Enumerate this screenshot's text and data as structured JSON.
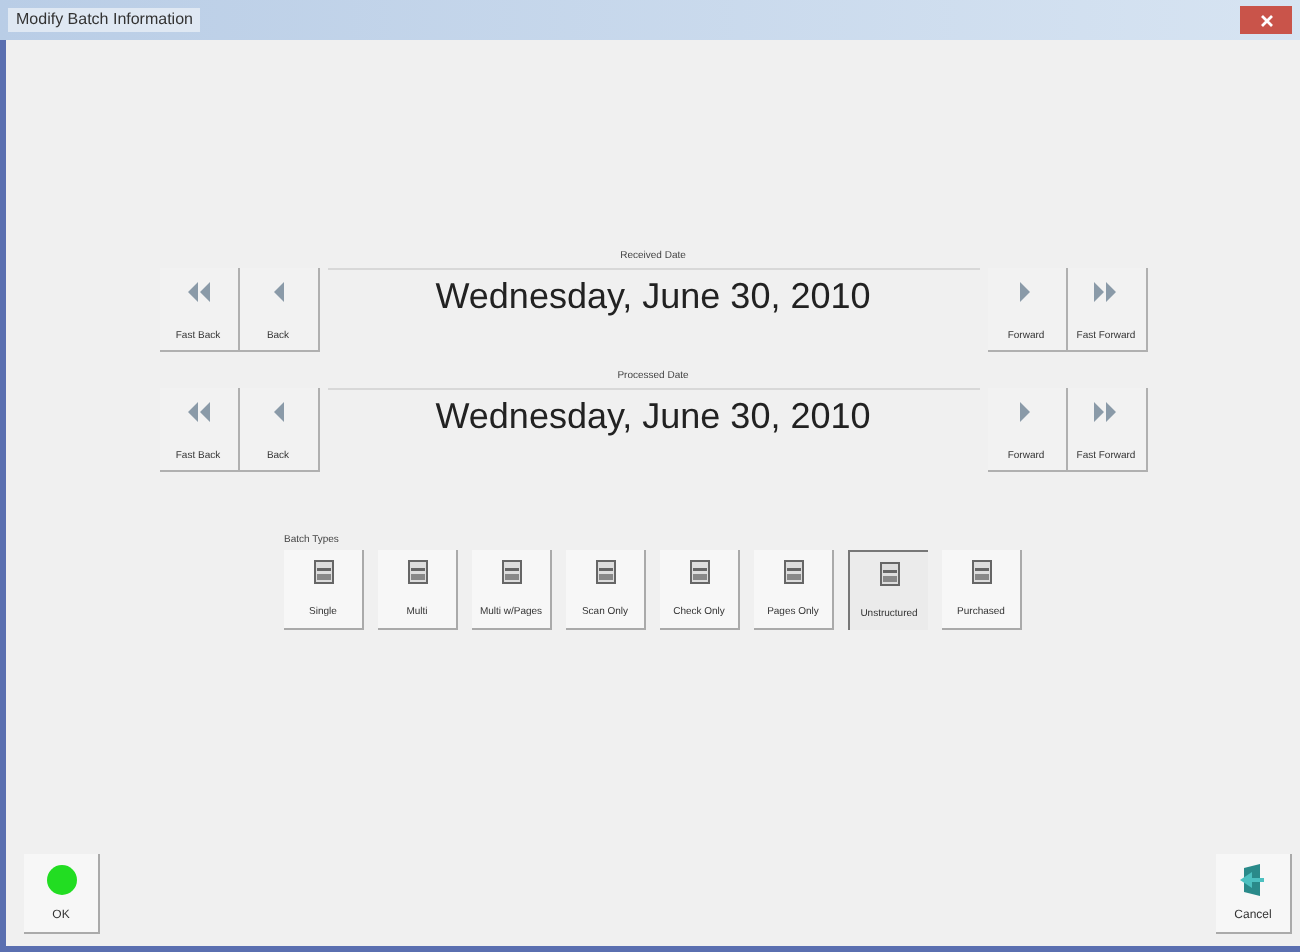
{
  "window": {
    "title": "Modify Batch Information"
  },
  "date_pickers": [
    {
      "label": "Received Date",
      "date": "Wednesday, June 30, 2010",
      "buttons": [
        {
          "kind": "fast-back",
          "label": "Fast Back"
        },
        {
          "kind": "back",
          "label": "Back"
        },
        {
          "kind": "forward",
          "label": "Forward"
        },
        {
          "kind": "fast-forward",
          "label": "Fast Forward"
        }
      ]
    },
    {
      "label": "Processed Date",
      "date": "Wednesday, June 30, 2010",
      "buttons": [
        {
          "kind": "fast-back",
          "label": "Fast Back"
        },
        {
          "kind": "back",
          "label": "Back"
        },
        {
          "kind": "forward",
          "label": "Forward"
        },
        {
          "kind": "fast-forward",
          "label": "Fast Forward"
        }
      ]
    }
  ],
  "batch_types": {
    "label": "Batch Types",
    "items": [
      {
        "label": "Single",
        "selected": false
      },
      {
        "label": "Multi",
        "selected": false
      },
      {
        "label": "Multi w/Pages",
        "selected": false
      },
      {
        "label": "Scan Only",
        "selected": false
      },
      {
        "label": "Check Only",
        "selected": false
      },
      {
        "label": "Pages Only",
        "selected": false
      },
      {
        "label": "Unstructured",
        "selected": true
      },
      {
        "label": "Purchased",
        "selected": false
      }
    ]
  },
  "footer": [
    {
      "kind": "ok",
      "label": "OK"
    },
    {
      "kind": "cancel",
      "label": "Cancel"
    }
  ]
}
